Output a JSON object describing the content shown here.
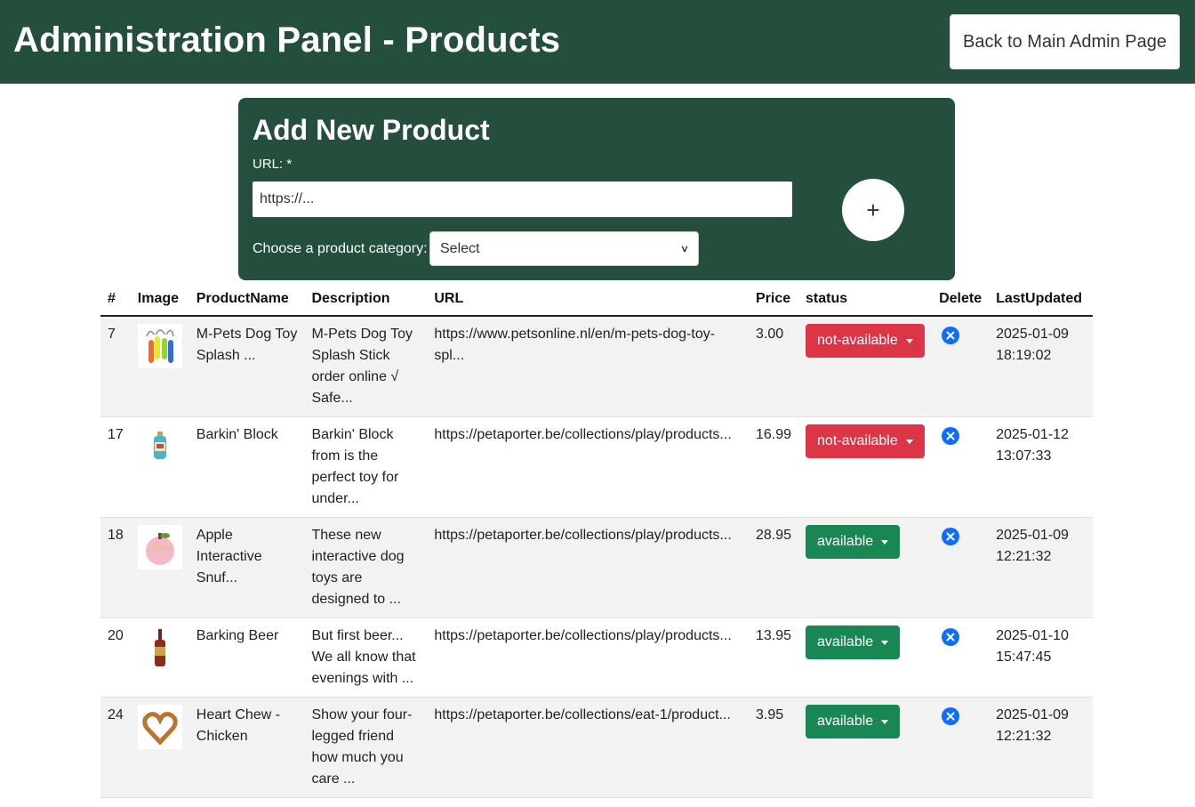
{
  "header": {
    "title": "Administration Panel - Products",
    "back_label": "Back to Main Admin Page"
  },
  "add_product": {
    "heading": "Add New Product",
    "url_label": "URL: *",
    "url_placeholder": "https://...",
    "category_label": "Choose a product category:",
    "category_selected": "Select",
    "add_icon": "plus-icon"
  },
  "table": {
    "columns": [
      "#",
      "Image",
      "ProductName",
      "Description",
      "URL",
      "Price",
      "status",
      "Delete",
      "LastUpdated"
    ],
    "rows": [
      {
        "id": "7",
        "image_icon": "dog-toy-sticks",
        "name": "M-Pets Dog Toy Splash ...",
        "description": "M-Pets Dog Toy Splash Stick order online √ Safe...",
        "url": "https://www.petsonline.nl/en/m-pets-dog-toy-spl...",
        "price": "3.00",
        "status": "not-available",
        "last_updated_date": "2025-01-09",
        "last_updated_time": "18:19:02"
      },
      {
        "id": "17",
        "image_icon": "bottle-toy",
        "name": "Barkin' Block",
        "description": "Barkin' Block from is the perfect toy for under...",
        "url": "https://petaporter.be/collections/play/products...",
        "price": "16.99",
        "status": "not-available",
        "last_updated_date": "2025-01-12",
        "last_updated_time": "13:07:33"
      },
      {
        "id": "18",
        "image_icon": "apple-plush",
        "name": "Apple Interactive Snuf...",
        "description": "These new interactive dog toys are designed to ...",
        "url": "https://petaporter.be/collections/play/products...",
        "price": "28.95",
        "status": "available",
        "last_updated_date": "2025-01-09",
        "last_updated_time": "12:21:32"
      },
      {
        "id": "20",
        "image_icon": "beer-bottle-toy",
        "name": "Barking Beer",
        "description": "But first beer... We all know that evenings with ...",
        "url": "https://petaporter.be/collections/play/products...",
        "price": "13.95",
        "status": "available",
        "last_updated_date": "2025-01-10",
        "last_updated_time": "15:47:45"
      },
      {
        "id": "24",
        "image_icon": "heart-chew",
        "name": "Heart Chew - Chicken",
        "description": "Show your four-legged friend how much you care ...",
        "url": "https://petaporter.be/collections/eat-1/product...",
        "price": "3.95",
        "status": "available",
        "last_updated_date": "2025-01-09",
        "last_updated_time": "12:21:32"
      }
    ]
  },
  "colors": {
    "brand_green": "#234f3c",
    "status_not_available": "#dc3545",
    "status_available": "#198754",
    "delete_blue": "#0d6efd"
  }
}
